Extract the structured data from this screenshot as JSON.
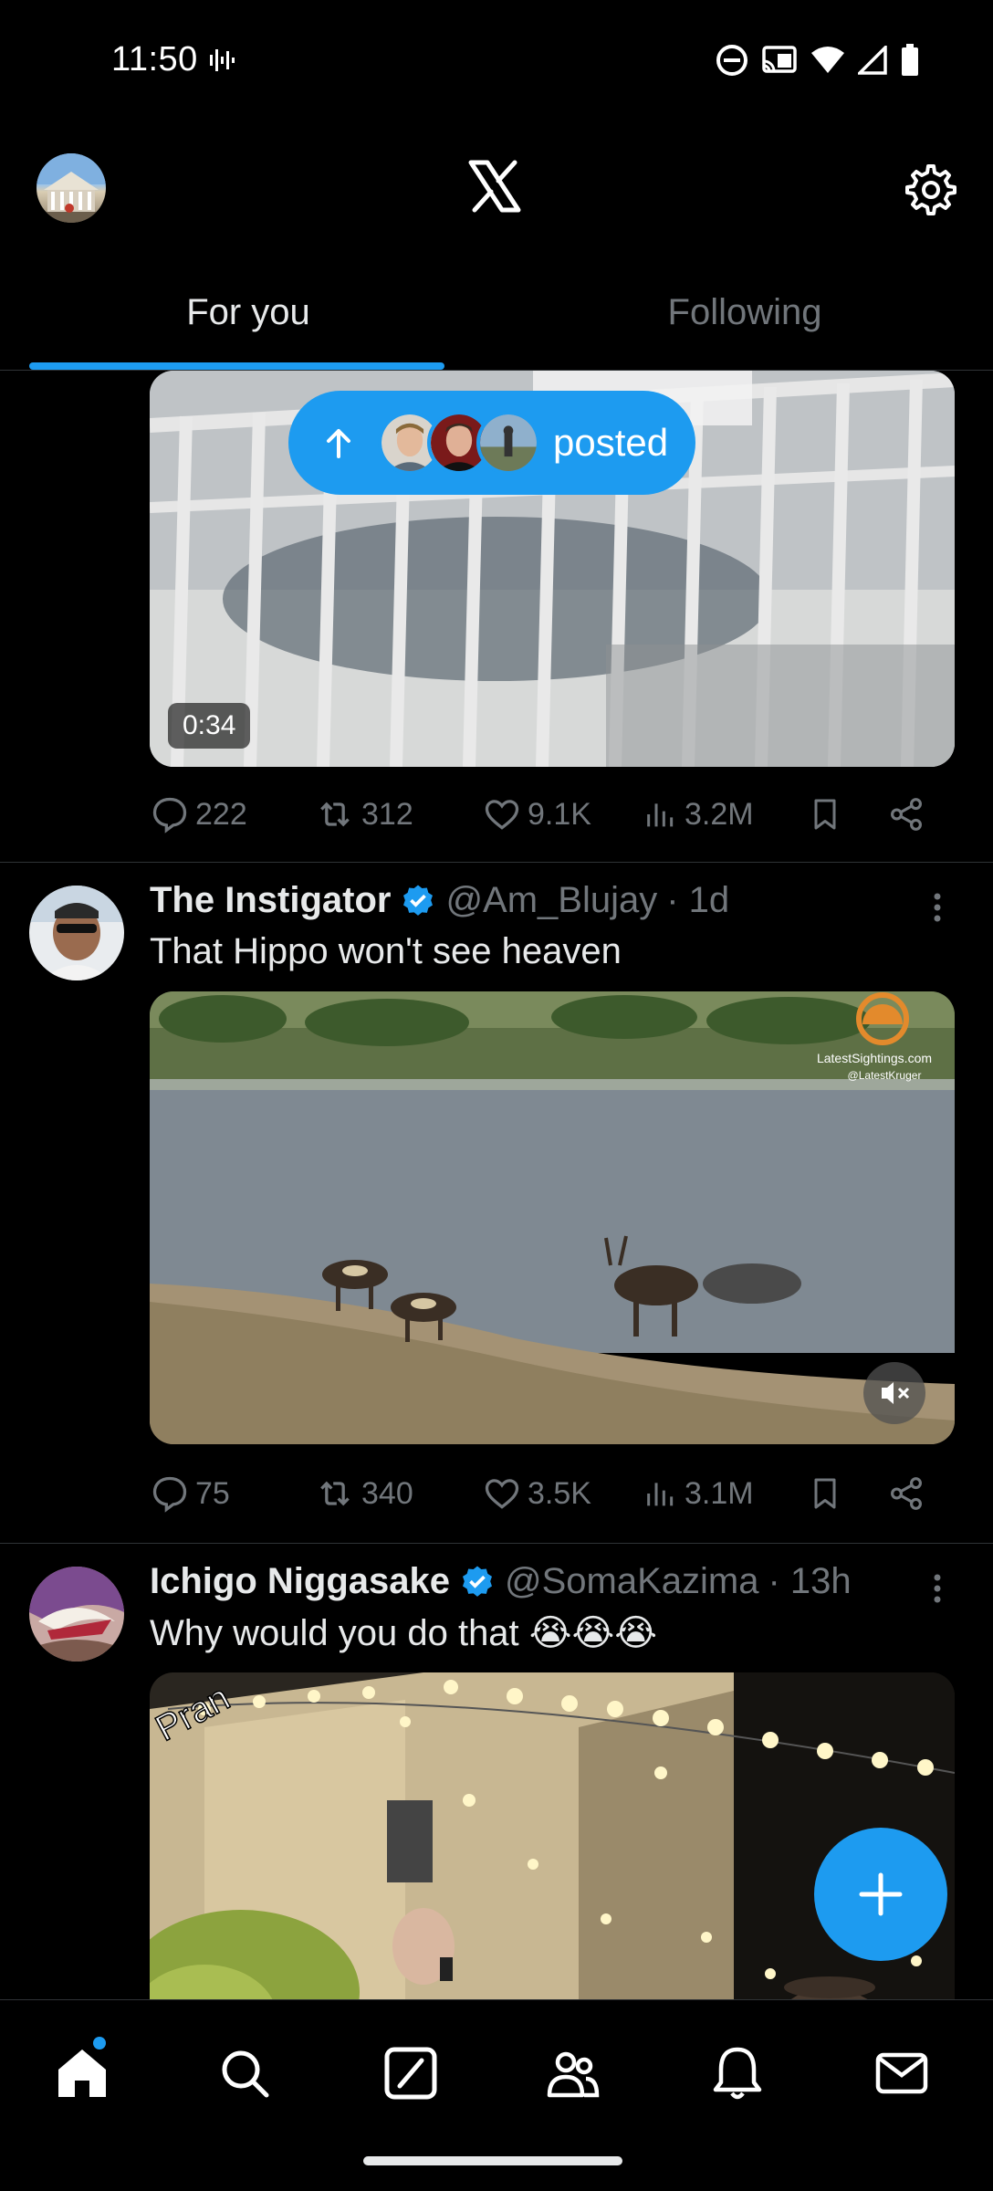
{
  "status_bar": {
    "time": "11:50"
  },
  "header": {
    "logo": "x-logo",
    "settings_icon": "gear-icon"
  },
  "tabs": [
    {
      "label": "For you",
      "active": true
    },
    {
      "label": "Following",
      "active": false
    }
  ],
  "new_posts_pill": {
    "label": "posted",
    "arrow_icon": "arrow-up-icon"
  },
  "posts": [
    {
      "video_duration": "0:34",
      "replies": "222",
      "reposts": "312",
      "likes": "9.1K",
      "views": "3.2M"
    },
    {
      "name": "The Instigator",
      "verified": true,
      "handle": "@Am_Blujay",
      "time": "· 1d",
      "text": "That Hippo won't see heaven",
      "watermark_site": "LatestSightings.com",
      "watermark_handle": "@LatestKruger",
      "replies": "75",
      "reposts": "340",
      "likes": "3.5K",
      "views": "3.1M"
    },
    {
      "name": "Ichigo Niggasake",
      "verified": true,
      "handle": "@SomaKazima",
      "time": "· 13h",
      "text": "Why would you do that 😭😭😭",
      "overlay_text": "Pran"
    }
  ],
  "bottom_nav": [
    "home-icon",
    "search-icon",
    "grok-icon",
    "communities-icon",
    "notifications-icon",
    "messages-icon"
  ],
  "colors": {
    "accent": "#1d9bf0",
    "background": "#000000",
    "muted": "#71767b",
    "divider": "#2f3336"
  }
}
